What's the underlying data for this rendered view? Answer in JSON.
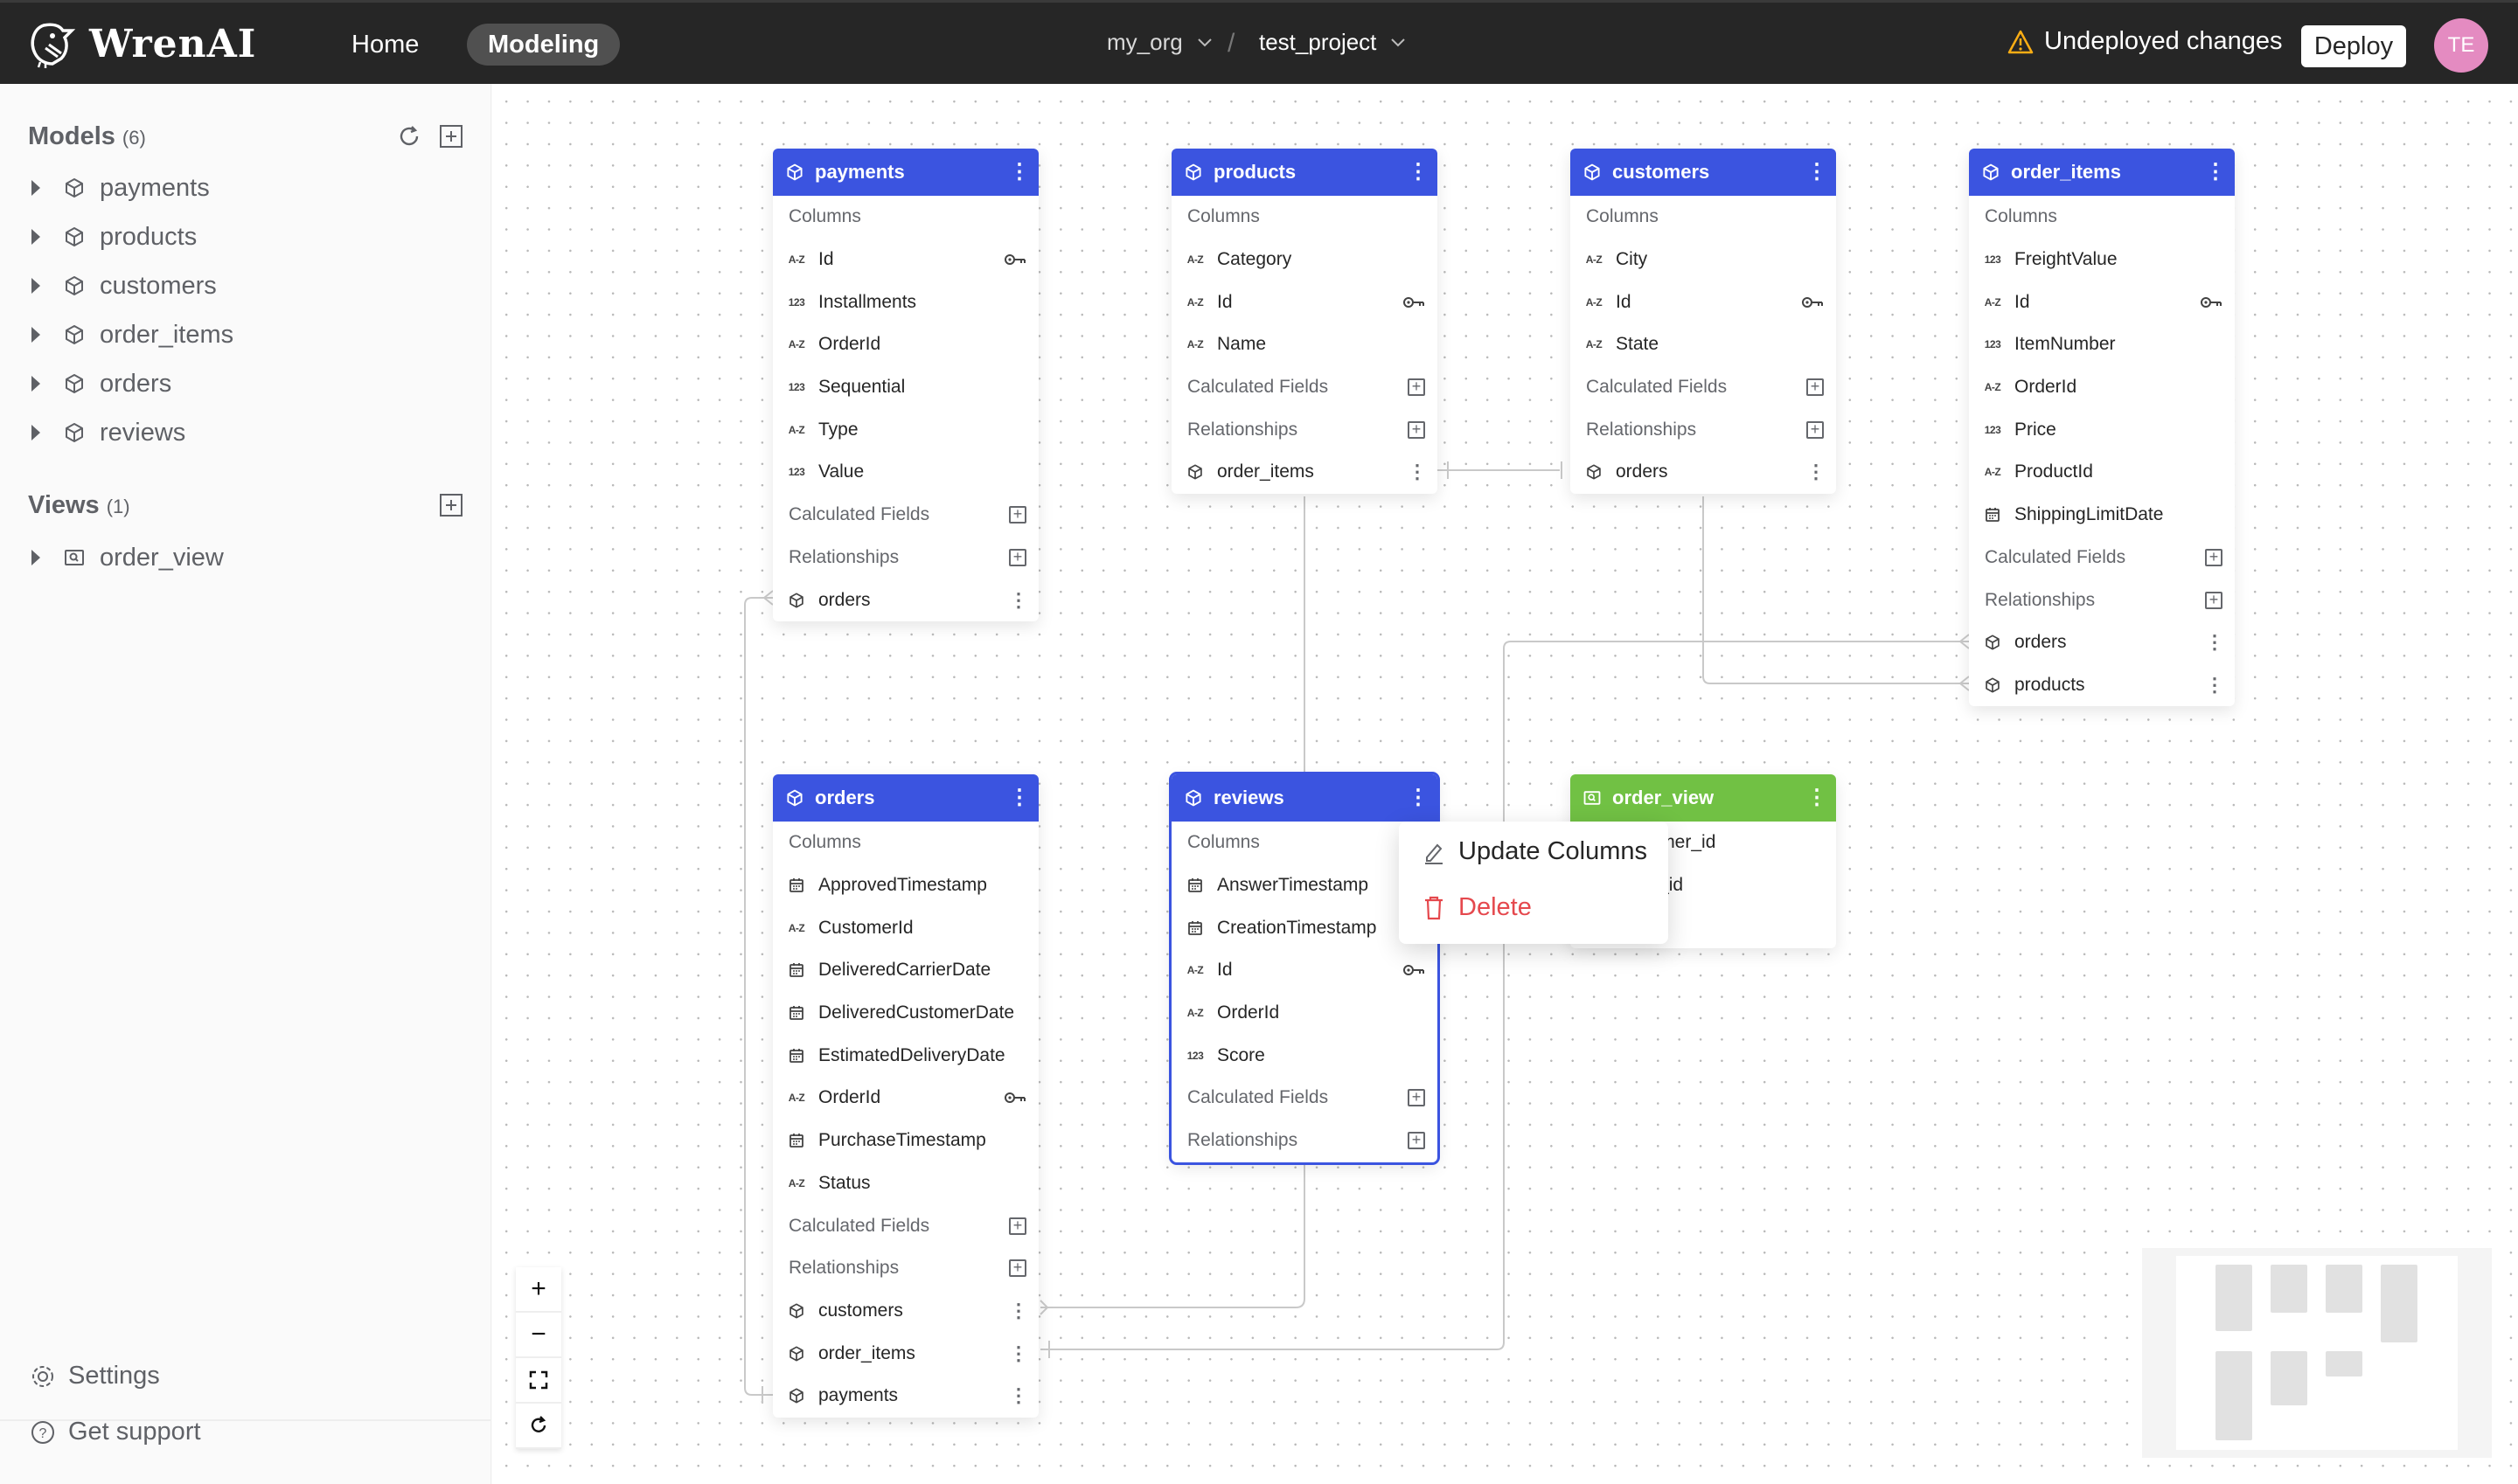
{
  "app": {
    "brand": "WrenAI",
    "nav": [
      {
        "label": "Home",
        "active": false
      },
      {
        "label": "Modeling",
        "active": true
      }
    ],
    "breadcrumb": {
      "org": "my_org",
      "project": "test_project",
      "separator": "/"
    },
    "status": {
      "text": "Undeployed changes",
      "icon": "warning-icon",
      "color": "#faad14"
    },
    "deploy_label": "Deploy",
    "user_initials": "TE"
  },
  "sidebar": {
    "models": {
      "title": "Models",
      "count": "(6)",
      "items": [
        "payments",
        "products",
        "customers",
        "order_items",
        "orders",
        "reviews"
      ]
    },
    "views": {
      "title": "Views",
      "count": "(1)",
      "items": [
        "order_view"
      ]
    },
    "footer": [
      {
        "label": "Settings",
        "icon": "gear-icon"
      },
      {
        "label": "Get support",
        "icon": "question-icon"
      }
    ]
  },
  "labels": {
    "columns": "Columns",
    "calculated_fields": "Calculated Fields",
    "relationships": "Relationships"
  },
  "colors": {
    "model_header": "#3b54e0",
    "view_header": "#71c144"
  },
  "nodes": [
    {
      "name": "payments",
      "kind": "model",
      "columns": [
        {
          "type": "A-Z",
          "name": "Id",
          "pk": true
        },
        {
          "type": "123",
          "name": "Installments"
        },
        {
          "type": "A-Z",
          "name": "OrderId"
        },
        {
          "type": "123",
          "name": "Sequential"
        },
        {
          "type": "A-Z",
          "name": "Type"
        },
        {
          "type": "123",
          "name": "Value"
        }
      ],
      "relationships": [
        "orders"
      ]
    },
    {
      "name": "products",
      "kind": "model",
      "columns": [
        {
          "type": "A-Z",
          "name": "Category"
        },
        {
          "type": "A-Z",
          "name": "Id",
          "pk": true
        },
        {
          "type": "A-Z",
          "name": "Name"
        }
      ],
      "relationships": [
        "order_items"
      ]
    },
    {
      "name": "customers",
      "kind": "model",
      "columns": [
        {
          "type": "A-Z",
          "name": "City"
        },
        {
          "type": "A-Z",
          "name": "Id",
          "pk": true
        },
        {
          "type": "A-Z",
          "name": "State"
        }
      ],
      "relationships": [
        "orders"
      ]
    },
    {
      "name": "order_items",
      "kind": "model",
      "columns": [
        {
          "type": "123",
          "name": "FreightValue"
        },
        {
          "type": "A-Z",
          "name": "Id",
          "pk": true
        },
        {
          "type": "123",
          "name": "ItemNumber"
        },
        {
          "type": "A-Z",
          "name": "OrderId"
        },
        {
          "type": "123",
          "name": "Price"
        },
        {
          "type": "A-Z",
          "name": "ProductId"
        },
        {
          "type": "date",
          "name": "ShippingLimitDate"
        }
      ],
      "relationships": [
        "orders",
        "products"
      ]
    },
    {
      "name": "orders",
      "kind": "model",
      "columns": [
        {
          "type": "date",
          "name": "ApprovedTimestamp"
        },
        {
          "type": "A-Z",
          "name": "CustomerId"
        },
        {
          "type": "date",
          "name": "DeliveredCarrierDate"
        },
        {
          "type": "date",
          "name": "DeliveredCustomerDate"
        },
        {
          "type": "date",
          "name": "EstimatedDeliveryDate"
        },
        {
          "type": "A-Z",
          "name": "OrderId",
          "pk": true
        },
        {
          "type": "date",
          "name": "PurchaseTimestamp"
        },
        {
          "type": "A-Z",
          "name": "Status"
        }
      ],
      "relationships": [
        "customers",
        "order_items",
        "payments"
      ]
    },
    {
      "name": "reviews",
      "kind": "model",
      "selected": true,
      "columns": [
        {
          "type": "date",
          "name": "AnswerTimestamp"
        },
        {
          "type": "date",
          "name": "CreationTimestamp"
        },
        {
          "type": "A-Z",
          "name": "Id",
          "pk": true
        },
        {
          "type": "A-Z",
          "name": "OrderId"
        },
        {
          "type": "123",
          "name": "Score"
        }
      ],
      "relationships": []
    },
    {
      "name": "order_view",
      "kind": "view",
      "columns": [
        {
          "type": "",
          "name": "customer_id"
        },
        {
          "type": "",
          "name": "order_id"
        }
      ],
      "relationships": []
    }
  ],
  "context_menu": {
    "items": [
      {
        "label": "Update Columns",
        "icon": "edit-icon"
      },
      {
        "label": "Delete",
        "icon": "trash-icon",
        "danger": true
      }
    ]
  },
  "canvas_controls": [
    {
      "label": "+",
      "name": "zoom-in-button"
    },
    {
      "label": "−",
      "name": "zoom-out-button"
    },
    {
      "label": "⛶",
      "name": "fit-view-button"
    },
    {
      "label": "↻",
      "name": "refresh-layout-button"
    }
  ]
}
